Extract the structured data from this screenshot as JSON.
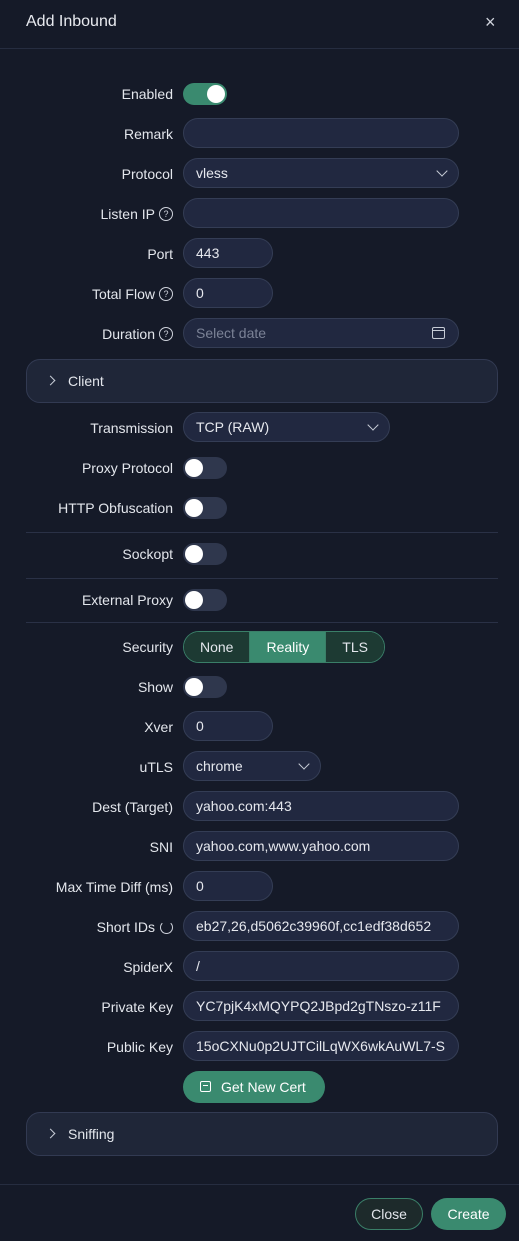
{
  "modal": {
    "title": "Add Inbound",
    "close_icon": "×"
  },
  "fields": {
    "enabled": {
      "label": "Enabled",
      "value": true
    },
    "remark": {
      "label": "Remark",
      "value": ""
    },
    "protocol": {
      "label": "Protocol",
      "value": "vless"
    },
    "listen_ip": {
      "label": "Listen IP",
      "value": ""
    },
    "port": {
      "label": "Port",
      "value": "443"
    },
    "total_flow": {
      "label": "Total Flow",
      "value": "0"
    },
    "duration": {
      "label": "Duration",
      "placeholder": "Select date"
    }
  },
  "panels": {
    "client": "Client",
    "sniffing": "Sniffing"
  },
  "transport": {
    "transmission": {
      "label": "Transmission",
      "value": "TCP (RAW)"
    },
    "proxy_protocol": {
      "label": "Proxy Protocol",
      "value": false
    },
    "http_obfuscation": {
      "label": "HTTP Obfuscation",
      "value": false
    },
    "sockopt": {
      "label": "Sockopt",
      "value": false
    },
    "external_proxy": {
      "label": "External Proxy",
      "value": false
    }
  },
  "security": {
    "label": "Security",
    "options": [
      "None",
      "Reality",
      "TLS"
    ],
    "selected": "Reality",
    "show": {
      "label": "Show",
      "value": false
    },
    "xver": {
      "label": "Xver",
      "value": "0"
    },
    "utls": {
      "label": "uTLS",
      "value": "chrome"
    },
    "dest": {
      "label": "Dest (Target)",
      "value": "yahoo.com:443"
    },
    "sni": {
      "label": "SNI",
      "value": "yahoo.com,www.yahoo.com"
    },
    "max_time_diff": {
      "label": "Max Time Diff (ms)",
      "value": "0"
    },
    "short_ids": {
      "label": "Short IDs",
      "value": "eb27,26,d5062c39960f,cc1edf38d652"
    },
    "spiderx": {
      "label": "SpiderX",
      "value": "/"
    },
    "private_key": {
      "label": "Private Key",
      "value": "YC7pjK4xMQYPQ2JBpd2gTNszo-z11F"
    },
    "public_key": {
      "label": "Public Key",
      "value": "15oCXNu0p2UJTCilLqWX6wkAuWL7-S"
    },
    "get_cert": "Get New Cert"
  },
  "footer": {
    "close": "Close",
    "create": "Create"
  },
  "colors": {
    "accent": "#3a8a6f",
    "background": "#151a28",
    "input": "#212840"
  }
}
